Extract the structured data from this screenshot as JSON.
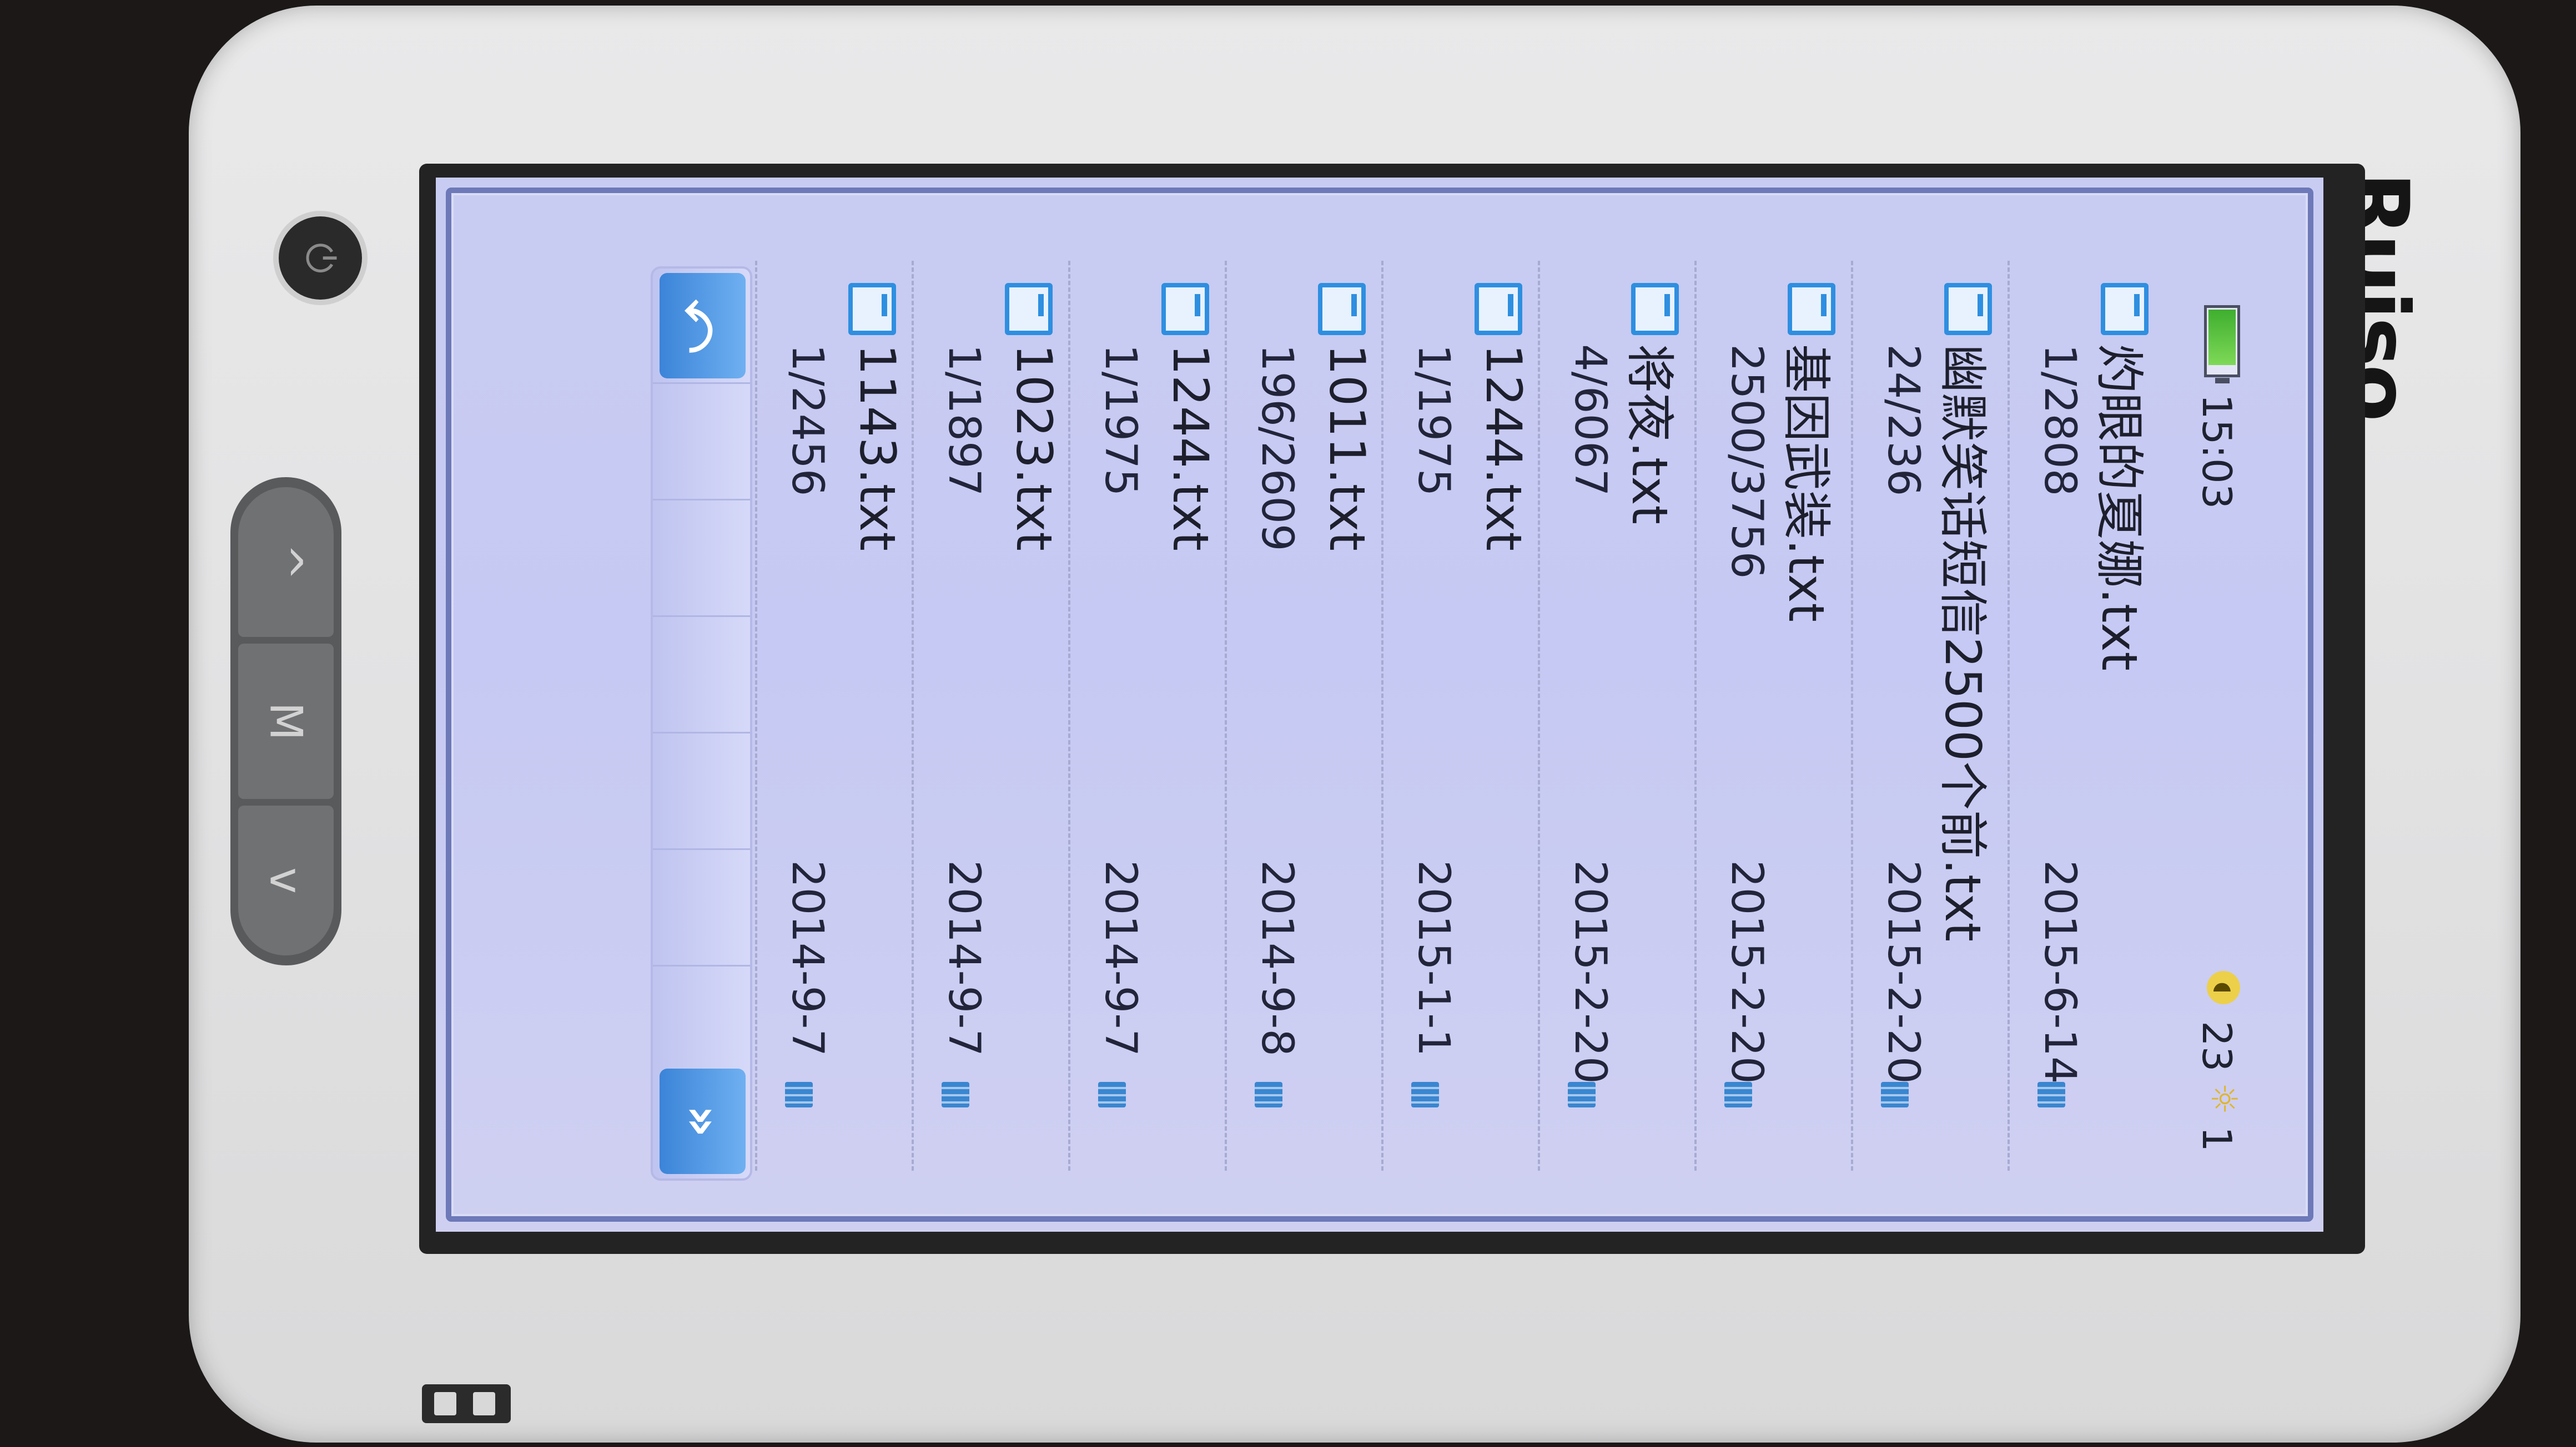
{
  "device": {
    "brand": "Ruiso"
  },
  "buttons": {
    "up": "^",
    "menu": "M",
    "down": "v"
  },
  "status": {
    "time": "15:03",
    "volume_icon": "speaker-icon",
    "volume": "23",
    "brightness_icon": "sun-icon",
    "brightness": "1"
  },
  "files": [
    {
      "name": "灼眼的夏娜.txt",
      "progress": "1/2808",
      "date": "2015-6-14"
    },
    {
      "name": "幽默笑话短信2500个前.txt",
      "progress": "24/236",
      "date": "2015-2-20"
    },
    {
      "name": "基因武装.txt",
      "progress": "2500/3756",
      "date": "2015-2-20"
    },
    {
      "name": "将夜.txt",
      "progress": "4/6067",
      "date": "2015-2-20"
    },
    {
      "name": "1244.txt",
      "progress": "1/1975",
      "date": "2015-1-1"
    },
    {
      "name": "1011.txt",
      "progress": "196/2609",
      "date": "2014-9-8"
    },
    {
      "name": "1244.txt",
      "progress": "1/1975",
      "date": "2014-9-7"
    },
    {
      "name": "1023.txt",
      "progress": "1/1897",
      "date": "2014-9-7"
    },
    {
      "name": "1143.txt",
      "progress": "1/2456",
      "date": "2014-9-7"
    }
  ],
  "toolbar": {
    "back_icon": "back-arrow-icon",
    "forward_icon": "forward-chevrons-icon"
  },
  "colors": {
    "accent": "#2e8fe0",
    "screen_bg": "#c8cbf3",
    "frame": "#6d79b8"
  }
}
